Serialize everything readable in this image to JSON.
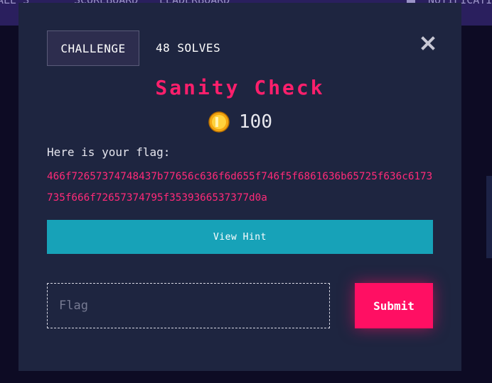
{
  "nav": {
    "item_1": "ALE S",
    "item_2": "SCOREBOARD",
    "item_3": "LEADERBOARD",
    "user": "NOTIFICATI"
  },
  "challenge": {
    "category": "CHALLENGE",
    "solves": "48 SOLVES",
    "name": "Sanity Check",
    "value": "100",
    "description_intro": "Here is your flag:",
    "flag_hex": "466f72657374748437b77656c636f6d655f746f5f6861636b65725f636c6173735f666f72657374795f3539366537377d0a"
  },
  "hint": {
    "label": "View Hint"
  },
  "submission": {
    "placeholder": "Flag",
    "submit_label": "Submit"
  },
  "colors": {
    "title": "#ff1f6c",
    "flag_text": "#ff2a78",
    "hint_button": "#17a2b8",
    "submit_button": "#ff0f63",
    "modal_bg": "#1e2540",
    "topbar_bg": "#2a1f5e"
  },
  "icons": {
    "close": "close-icon",
    "coin": "coin-icon",
    "user": "user-icon"
  }
}
